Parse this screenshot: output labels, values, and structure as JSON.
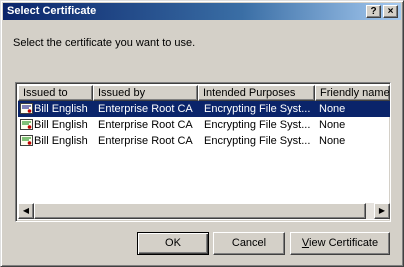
{
  "window": {
    "title": "Select Certificate",
    "help_label": "?",
    "close_label": "×"
  },
  "prompt": "Select the certificate you want to use.",
  "list": {
    "columns": [
      "Issued to",
      "Issued by",
      "Intended Purposes",
      "Friendly name"
    ],
    "rows": [
      [
        "Bill English",
        "Enterprise Root CA",
        "Encrypting File Syst...",
        "None"
      ],
      [
        "Bill English",
        "Enterprise Root CA",
        "Encrypting File Syst...",
        "None"
      ],
      [
        "Bill English",
        "Enterprise Root CA",
        "Encrypting File Syst...",
        "None"
      ]
    ],
    "selected_row": 0
  },
  "scrollbar": {
    "left_arrow": "◀",
    "right_arrow": "▶"
  },
  "buttons": {
    "ok": "OK",
    "cancel": "Cancel",
    "view": "View Certificate"
  }
}
